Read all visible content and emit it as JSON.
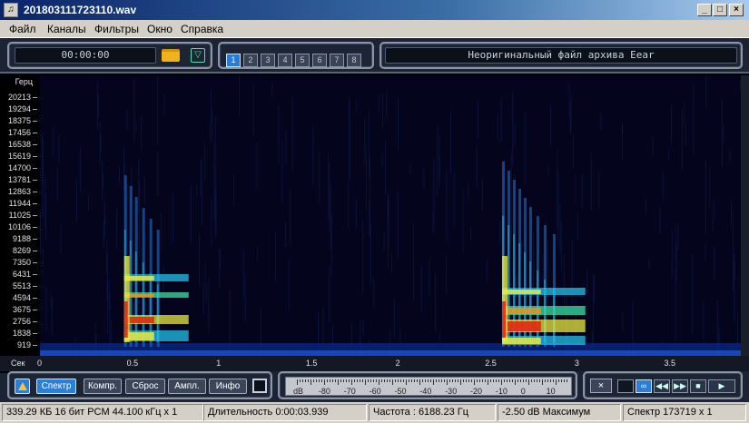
{
  "window": {
    "title": "201803111723110.wav",
    "minimize": "_",
    "maximize": "□",
    "close": "×"
  },
  "menu": [
    "Файл",
    "Каналы",
    "Фильтры",
    "Окно",
    "Справка"
  ],
  "top_panel": {
    "time": "00:00:00",
    "channels": [
      "1",
      "2",
      "3",
      "4",
      "5",
      "6",
      "7",
      "8"
    ],
    "active_channel": "1",
    "info_text": "Неоригинальный файл архива Eear"
  },
  "spectrogram": {
    "y_unit": "Герц",
    "x_unit": "Сек",
    "y_ticks": [
      "20213",
      "19294",
      "18375",
      "17456",
      "16538",
      "15619",
      "14700",
      "13781",
      "12863",
      "11944",
      "11025",
      "10106",
      "9188",
      "8269",
      "7350",
      "6431",
      "5513",
      "4594",
      "3675",
      "2756",
      "1838",
      "919"
    ],
    "x_ticks": [
      "0",
      "0.5",
      "1",
      "1.5",
      "2",
      "2.5",
      "3",
      "3.5"
    ],
    "duration_sec": 3.939,
    "max_freq_hz": 22050,
    "events": [
      {
        "start_sec": 0.47,
        "end_sec": 0.95,
        "name": "sound-burst-1"
      },
      {
        "start_sec": 2.58,
        "end_sec": 3.2,
        "name": "sound-burst-2"
      }
    ]
  },
  "bottom_panel": {
    "buttons": [
      "Спектр",
      "Компр.",
      "Сброс",
      "Ампл.",
      "Инфо"
    ],
    "active_button": "Спектр",
    "db_scale": [
      "dB",
      "-80",
      "-70",
      "-60",
      "-50",
      "-40",
      "-30",
      "-20",
      "-10",
      "0",
      "10"
    ]
  },
  "transport": {
    "x_button": "×"
  },
  "status": {
    "format": "339.29 КБ 16 бит PCM 44.100 кГц x 1",
    "duration": "Длительность 0:00:03.939",
    "frequency": "Частота : 6188.23 Гц",
    "level": "-2.50 dB Максимум",
    "spectrum": "Спектр 173719 x 1"
  },
  "colors": {
    "accent": "#2c7ed6",
    "panel": "#1d2433",
    "spectrogram_bg": "#04051d"
  }
}
